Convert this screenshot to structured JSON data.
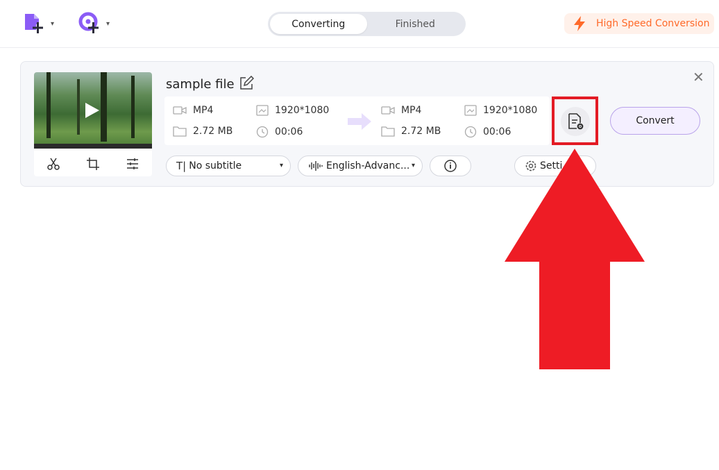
{
  "toolbar": {
    "add_file_icon": "add-file-icon",
    "add_media_icon": "add-media-icon",
    "chevron_icon": "chevron-down-icon",
    "chevron_glyph": "▾"
  },
  "tabs": [
    {
      "label": "Converting",
      "active": true
    },
    {
      "label": "Finished",
      "active": false
    }
  ],
  "high_speed": {
    "label": "High Speed Conversion",
    "icon": "lightning-icon",
    "color": "#ff6a2a"
  },
  "file": {
    "name": "sample file",
    "source": {
      "format": "MP4",
      "resolution": "1920*1080",
      "size": "2.72 MB",
      "duration": "00:06"
    },
    "target": {
      "format": "MP4",
      "resolution": "1920*1080",
      "size": "2.72 MB",
      "duration": "00:06"
    },
    "convert_label": "Convert",
    "subtitle": "No subtitle",
    "audio": "English-Advanc...",
    "settings_label": "Setti",
    "close_glyph": "✕"
  },
  "colors": {
    "accent": "#8b5cf6",
    "highlight": "#e31b25"
  }
}
